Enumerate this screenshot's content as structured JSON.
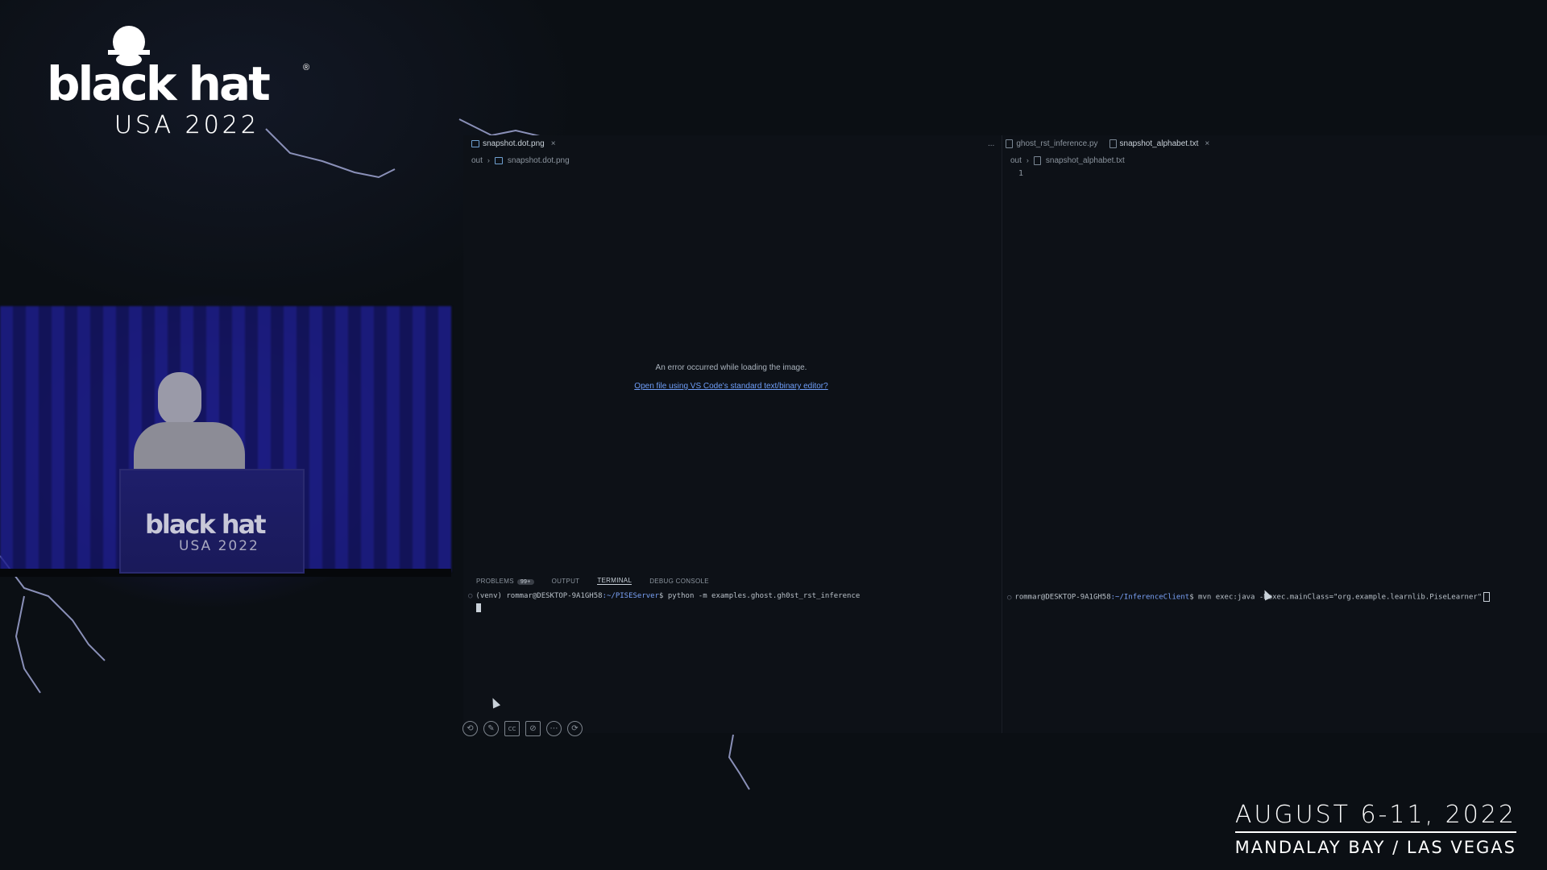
{
  "event": {
    "brand": "black hat",
    "brand_reg": "®",
    "edition": "USA 2022",
    "dates": "AUGUST 6-11, 2022",
    "venue": "MANDALAY BAY / LAS VEGAS"
  },
  "podium": {
    "brand": "black hat",
    "edition": "USA 2022"
  },
  "left_editor": {
    "tabs": [
      {
        "label": "snapshot.dot.png",
        "active": true
      }
    ],
    "breadcrumb": [
      "out",
      "snapshot.dot.png"
    ],
    "error_message": "An error occurred while loading the image.",
    "open_link": "Open file using VS Code's standard text/binary editor?"
  },
  "right_editor": {
    "more_label": "...",
    "tabs": [
      {
        "label": "ghost_rst_inference.py",
        "active": false
      },
      {
        "label": "snapshot_alphabet.txt",
        "active": true
      }
    ],
    "breadcrumb": [
      "out",
      "snapshot_alphabet.txt"
    ],
    "line_number": "1"
  },
  "panel": {
    "tabs": [
      "PROBLEMS",
      "OUTPUT",
      "TERMINAL",
      "DEBUG CONSOLE"
    ],
    "problems_badge": "99+",
    "active_tab": "TERMINAL"
  },
  "left_terminal": {
    "prefix": "(venv)",
    "user": "rommar@DESKTOP-9A1GH58",
    "path": ":~/PISEServer",
    "command": "$ python -m examples.ghost.gh0st_rst_inference"
  },
  "right_terminal": {
    "user": "rommar@DESKTOP-9A1GH58",
    "path": ":~/InferenceClient",
    "command": "$ mvn exec:java -Dexec.mainClass=\"org.example.learnlib.PiseLearner\""
  },
  "player_controls": [
    {
      "name": "back-icon",
      "glyph": "⟲"
    },
    {
      "name": "pencil-icon",
      "glyph": "✎"
    },
    {
      "name": "captions-icon",
      "glyph": "CC"
    },
    {
      "name": "camera-off-icon",
      "glyph": "⊘"
    },
    {
      "name": "more-icon",
      "glyph": "⋯"
    },
    {
      "name": "forward-icon",
      "glyph": "⟳"
    }
  ],
  "colors": {
    "background": "#0b0f14",
    "stage_blue": "#1e1e8a",
    "ide_bg": "#0d1117",
    "link": "#6f9ef8",
    "path": "#7aa2f7"
  }
}
